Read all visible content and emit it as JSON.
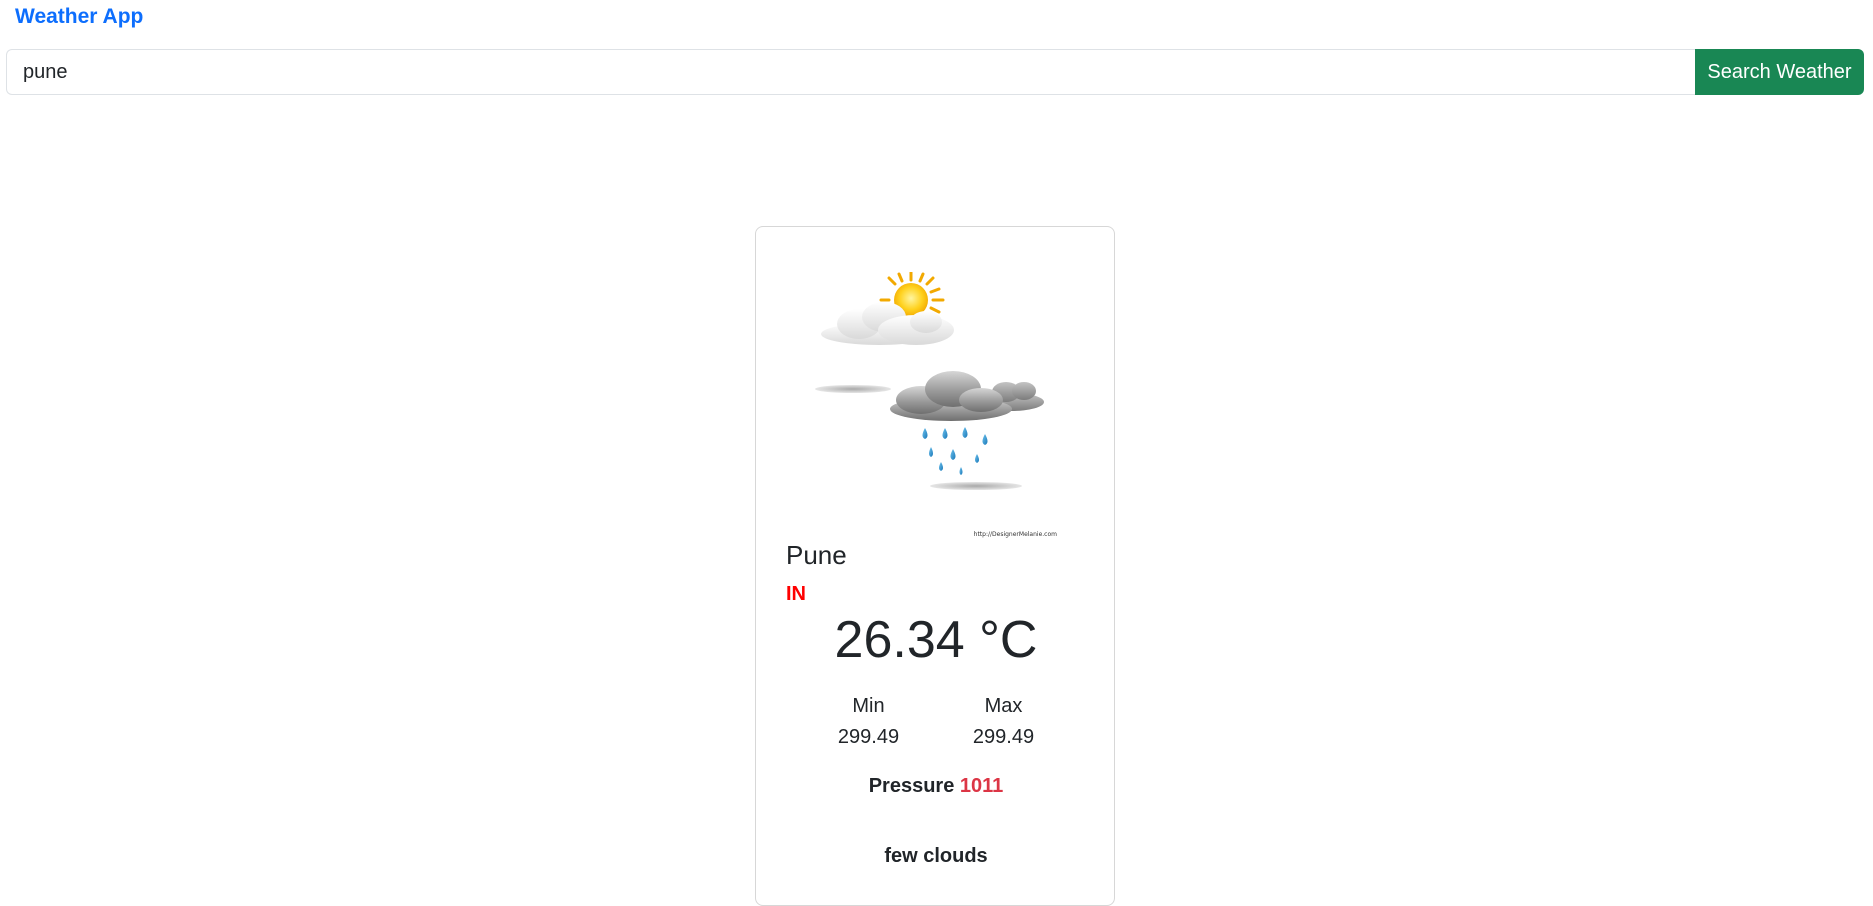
{
  "app": {
    "title": "Weather App"
  },
  "search": {
    "value": "pune",
    "button_label": "Search Weather"
  },
  "weather": {
    "image_caption": "http://DesignerMelanie.com",
    "city": "Pune",
    "country": "IN",
    "temperature": "26.34 °C",
    "min_label": "Min",
    "min_value": "299.49",
    "max_label": "Max",
    "max_value": "299.49",
    "pressure_label": "Pressure",
    "pressure_value": "1011",
    "description": "few clouds"
  },
  "colors": {
    "brand": "#0d6efd",
    "button": "#198754",
    "country": "#ff0000",
    "pressure_value": "#dc3545"
  }
}
